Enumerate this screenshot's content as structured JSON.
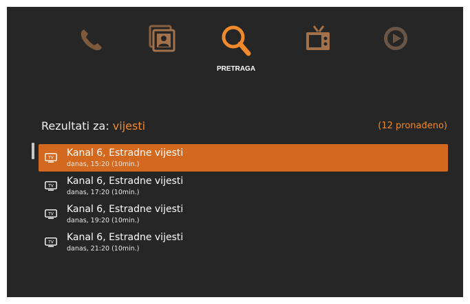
{
  "nav": {
    "items": [
      {
        "icon": "phone-icon",
        "label": ""
      },
      {
        "icon": "photo-album-icon",
        "label": ""
      },
      {
        "icon": "search-icon",
        "label": "PRETRAGA",
        "active": true
      },
      {
        "icon": "tv-icon",
        "label": ""
      },
      {
        "icon": "play-icon",
        "label": ""
      }
    ]
  },
  "results": {
    "prefix": "Rezultati za: ",
    "query": "vijesti",
    "count": "(12 pronađeno)"
  },
  "list": {
    "items": [
      {
        "icon": "tv-icon",
        "badge": "TV",
        "title": "Kanal 6, Estradne vijesti",
        "subtitle": "danas, 15:20 (10min.)",
        "selected": true
      },
      {
        "icon": "tv-icon",
        "badge": "TV",
        "title": "Kanal 6, Estradne vijesti",
        "subtitle": "danas, 17:20 (10min.)"
      },
      {
        "icon": "tv-icon",
        "badge": "TV",
        "title": "Kanal 6, Estradne vijesti",
        "subtitle": "danas, 19:20 (10min.)"
      },
      {
        "icon": "tv-icon",
        "badge": "TV",
        "title": "Kanal 6, Estradne vijesti",
        "subtitle": "danas, 21:20 (10min.)"
      }
    ]
  },
  "colors": {
    "background": "#262626",
    "accent": "#f08a2c",
    "selection": "#d2691e",
    "inactive_icon": "#7d5a3c"
  }
}
